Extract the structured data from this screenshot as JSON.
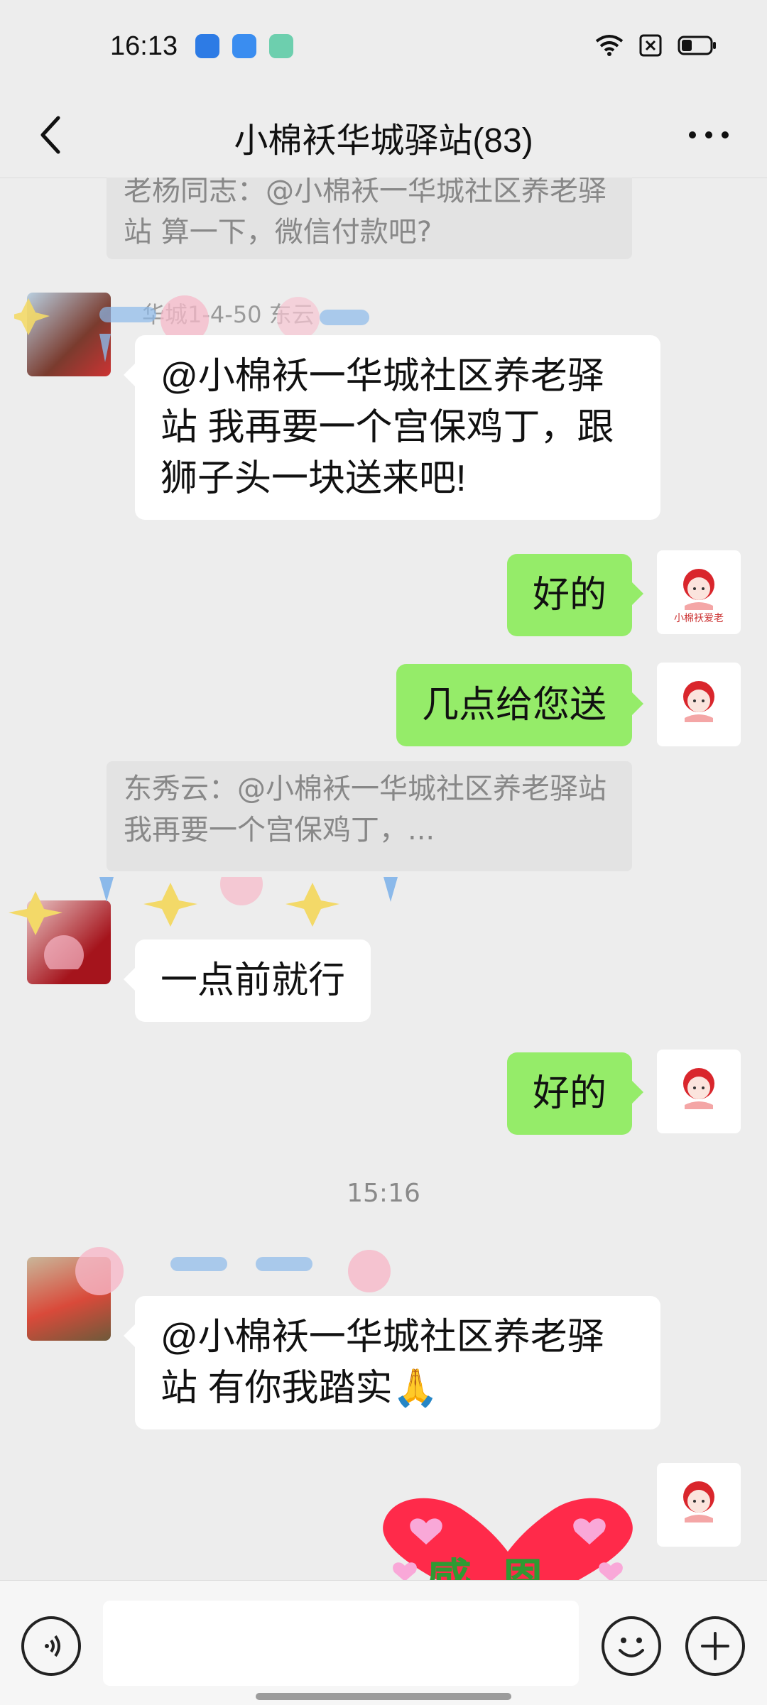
{
  "status_bar": {
    "time": "16:13"
  },
  "header": {
    "title": "小棉袄华城驿站(83)"
  },
  "messages": {
    "quote_1": "老杨同志：@小棉袄一华城社区养老驿站 算一下，微信付款吧?",
    "sender_1": "华城1-4-50 东云",
    "msg_1": "@小棉袄一华城社区养老驿站  我再要一个宫保鸡丁，跟狮子头一块送来吧!",
    "reply_ok_1": "好的",
    "reply_time": "几点给您送",
    "quote_2": "东秀云：@小棉袄一华城社区养老驿站 我再要一个宫保鸡丁，...",
    "msg_2": "一点前就行",
    "reply_ok_2": "好的",
    "timestamp": "15:16",
    "msg_3": "@小棉袄一华城社区养老驿站  有你我踏实🙏",
    "self_avatar_text": "小棉袄爱老",
    "sticker_text": "感恩"
  },
  "input": {
    "placeholder": ""
  },
  "colors": {
    "bubble_out": "#95ec69",
    "bubble_in": "#ffffff",
    "background": "#ededed"
  }
}
